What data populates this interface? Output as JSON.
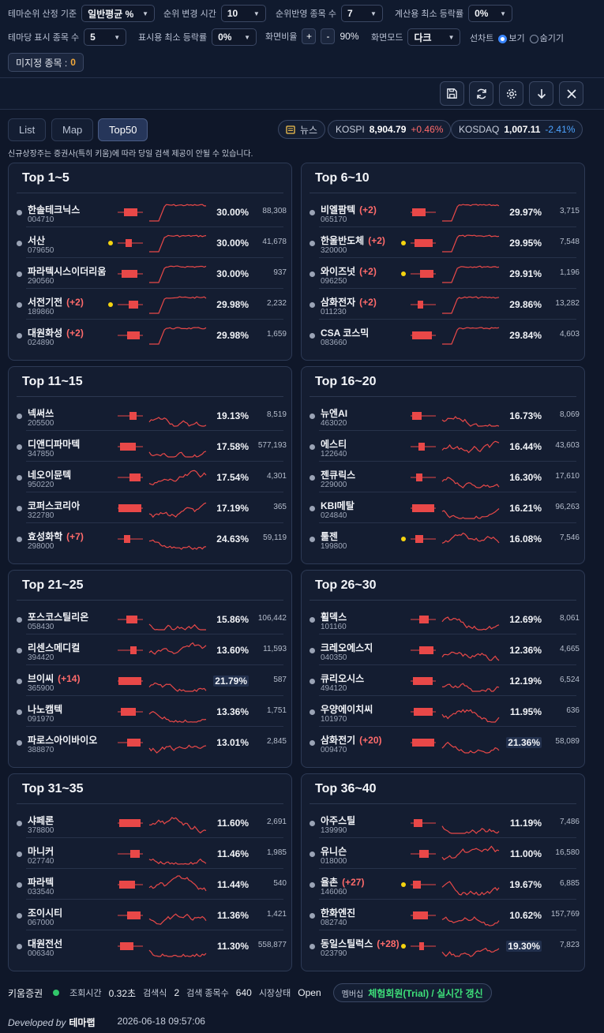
{
  "controls": {
    "theme_rank_basis_label": "테마순위 산정 기준",
    "theme_rank_basis_value": "일반평균 %",
    "rank_change_time_label": "순위 변경 시간",
    "rank_change_time_value": "10",
    "rank_stock_count_label": "순위반영 종목 수",
    "rank_stock_count_value": "7",
    "calc_min_rise_label": "계산용 최소 등락률",
    "calc_min_rise_value": "0%",
    "per_theme_count_label": "테마당 표시 종목 수",
    "per_theme_count_value": "5",
    "display_min_rise_label": "표시용 최소 등락률",
    "display_min_rise_value": "0%",
    "screen_ratio_label": "화면비율",
    "plus": "+",
    "minus": "-",
    "screen_ratio_value": "90%",
    "screen_mode_label": "화면모드",
    "screen_mode_value": "다크",
    "line_chart_label": "선차트",
    "show_label": "보기",
    "hide_label": "숨기기",
    "unassigned_label": "미지정 종목 :",
    "unassigned_count": "0"
  },
  "toolbar_icons": [
    "save-icon",
    "refresh-icon",
    "settings-icon",
    "download-icon",
    "close-icon"
  ],
  "tabs": [
    "List",
    "Map",
    "Top50"
  ],
  "active_tab": "Top50",
  "news_label": "뉴스",
  "indices": [
    {
      "name": "KOSPI",
      "value": "8,904.79",
      "change": "+0.46%",
      "dir": "up"
    },
    {
      "name": "KOSDAQ",
      "value": "1,007.11",
      "change": "-2.41%",
      "dir": "dn"
    }
  ],
  "notice": "신규상장주는 증권사(특히 키움)에 따라 당일 검색 제공이 안될 수 있습니다.",
  "panels": [
    {
      "title": "Top 1~5",
      "items": [
        {
          "name": "한솔테크닉스",
          "code": "004710",
          "tag": "",
          "pct": "30.00%",
          "vol": "88,308",
          "ydot": false,
          "hl": false
        },
        {
          "name": "서산",
          "code": "079650",
          "tag": "",
          "pct": "30.00%",
          "vol": "41,678",
          "ydot": true,
          "hl": false
        },
        {
          "name": "파라텍시스이더리움",
          "code": "290560",
          "tag": "",
          "pct": "30.00%",
          "vol": "937",
          "ydot": false,
          "hl": false
        },
        {
          "name": "서전기전",
          "code": "189860",
          "tag": "(+2)",
          "pct": "29.98%",
          "vol": "2,232",
          "ydot": true,
          "hl": false
        },
        {
          "name": "대원화성",
          "code": "024890",
          "tag": "(+2)",
          "pct": "29.98%",
          "vol": "1,659",
          "ydot": false,
          "hl": false
        }
      ]
    },
    {
      "title": "Top 6~10",
      "items": [
        {
          "name": "비엘팜텍",
          "code": "065170",
          "tag": "(+2)",
          "pct": "29.97%",
          "vol": "3,715",
          "ydot": false,
          "hl": false
        },
        {
          "name": "한울반도체",
          "code": "320000",
          "tag": "(+2)",
          "pct": "29.95%",
          "vol": "7,548",
          "ydot": true,
          "hl": false
        },
        {
          "name": "와이즈넛",
          "code": "096250",
          "tag": "(+2)",
          "pct": "29.91%",
          "vol": "1,196",
          "ydot": true,
          "hl": false
        },
        {
          "name": "삼화전자",
          "code": "011230",
          "tag": "(+2)",
          "pct": "29.86%",
          "vol": "13,282",
          "ydot": false,
          "hl": false
        },
        {
          "name": "CSA 코스믹",
          "code": "083660",
          "tag": "",
          "pct": "29.84%",
          "vol": "4,603",
          "ydot": false,
          "hl": false
        }
      ]
    },
    {
      "title": "Top 11~15",
      "items": [
        {
          "name": "넥써쓰",
          "code": "205500",
          "tag": "",
          "pct": "19.13%",
          "vol": "8,519",
          "ydot": false,
          "hl": false
        },
        {
          "name": "디앤디파마텍",
          "code": "347850",
          "tag": "",
          "pct": "17.58%",
          "vol": "577,193",
          "ydot": false,
          "hl": false
        },
        {
          "name": "네오이뮨텍",
          "code": "950220",
          "tag": "",
          "pct": "17.54%",
          "vol": "4,301",
          "ydot": false,
          "hl": false
        },
        {
          "name": "코퍼스코리아",
          "code": "322780",
          "tag": "",
          "pct": "17.19%",
          "vol": "365",
          "ydot": false,
          "hl": false
        },
        {
          "name": "효성화학",
          "code": "298000",
          "tag": "(+7)",
          "pct": "24.63%",
          "vol": "59,119",
          "ydot": false,
          "hl": false
        }
      ]
    },
    {
      "title": "Top 16~20",
      "items": [
        {
          "name": "뉴엔AI",
          "code": "463020",
          "tag": "",
          "pct": "16.73%",
          "vol": "8,069",
          "ydot": false,
          "hl": false
        },
        {
          "name": "에스티",
          "code": "122640",
          "tag": "",
          "pct": "16.44%",
          "vol": "43,603",
          "ydot": false,
          "hl": false
        },
        {
          "name": "젠큐릭스",
          "code": "229000",
          "tag": "",
          "pct": "16.30%",
          "vol": "17,610",
          "ydot": false,
          "hl": false
        },
        {
          "name": "KBI메탈",
          "code": "024840",
          "tag": "",
          "pct": "16.21%",
          "vol": "96,263",
          "ydot": false,
          "hl": false
        },
        {
          "name": "툴젠",
          "code": "199800",
          "tag": "",
          "pct": "16.08%",
          "vol": "7,546",
          "ydot": true,
          "hl": false
        }
      ]
    },
    {
      "title": "Top 21~25",
      "items": [
        {
          "name": "포스코스틸리온",
          "code": "058430",
          "tag": "",
          "pct": "15.86%",
          "vol": "106,442",
          "ydot": false,
          "hl": false
        },
        {
          "name": "리센스메디컬",
          "code": "394420",
          "tag": "",
          "pct": "13.60%",
          "vol": "11,593",
          "ydot": false,
          "hl": false
        },
        {
          "name": "브이씨",
          "code": "365900",
          "tag": "(+14)",
          "pct": "21.79%",
          "vol": "587",
          "ydot": false,
          "hl": true
        },
        {
          "name": "나노캠텍",
          "code": "091970",
          "tag": "",
          "pct": "13.36%",
          "vol": "1,751",
          "ydot": false,
          "hl": false
        },
        {
          "name": "파로스아이바이오",
          "code": "388870",
          "tag": "",
          "pct": "13.01%",
          "vol": "2,845",
          "ydot": false,
          "hl": false
        }
      ]
    },
    {
      "title": "Top 26~30",
      "items": [
        {
          "name": "휠덱스",
          "code": "101160",
          "tag": "",
          "pct": "12.69%",
          "vol": "8,061",
          "ydot": false,
          "hl": false
        },
        {
          "name": "크레오에스지",
          "code": "040350",
          "tag": "",
          "pct": "12.36%",
          "vol": "4,665",
          "ydot": false,
          "hl": false
        },
        {
          "name": "큐리오시스",
          "code": "494120",
          "tag": "",
          "pct": "12.19%",
          "vol": "6,524",
          "ydot": false,
          "hl": false
        },
        {
          "name": "우양에이치씨",
          "code": "101970",
          "tag": "",
          "pct": "11.95%",
          "vol": "636",
          "ydot": false,
          "hl": false
        },
        {
          "name": "삼화전기",
          "code": "009470",
          "tag": "(+20)",
          "pct": "21.36%",
          "vol": "58,089",
          "ydot": false,
          "hl": true
        }
      ]
    },
    {
      "title": "Top 31~35",
      "items": [
        {
          "name": "샤페론",
          "code": "378800",
          "tag": "",
          "pct": "11.60%",
          "vol": "2,691",
          "ydot": false,
          "hl": false
        },
        {
          "name": "마니커",
          "code": "027740",
          "tag": "",
          "pct": "11.46%",
          "vol": "1,985",
          "ydot": false,
          "hl": false
        },
        {
          "name": "파라텍",
          "code": "033540",
          "tag": "",
          "pct": "11.44%",
          "vol": "540",
          "ydot": false,
          "hl": false
        },
        {
          "name": "조이시티",
          "code": "067000",
          "tag": "",
          "pct": "11.36%",
          "vol": "1,421",
          "ydot": false,
          "hl": false
        },
        {
          "name": "대원전선",
          "code": "006340",
          "tag": "",
          "pct": "11.30%",
          "vol": "558,877",
          "ydot": false,
          "hl": false
        }
      ]
    },
    {
      "title": "Top 36~40",
      "items": [
        {
          "name": "아주스틸",
          "code": "139990",
          "tag": "",
          "pct": "11.19%",
          "vol": "7,486",
          "ydot": false,
          "hl": false
        },
        {
          "name": "유니슨",
          "code": "018000",
          "tag": "",
          "pct": "11.00%",
          "vol": "16,580",
          "ydot": false,
          "hl": false
        },
        {
          "name": "율촌",
          "code": "146060",
          "tag": "(+27)",
          "pct": "19.67%",
          "vol": "6,885",
          "ydot": true,
          "hl": false
        },
        {
          "name": "한화엔진",
          "code": "082740",
          "tag": "",
          "pct": "10.62%",
          "vol": "157,769",
          "ydot": false,
          "hl": false
        },
        {
          "name": "동일스틸럭스",
          "code": "023790",
          "tag": "(+28)",
          "pct": "19.30%",
          "vol": "7,823",
          "ydot": true,
          "hl": true
        }
      ]
    }
  ],
  "status": {
    "broker": "키움증권",
    "query_time_label": "조회시간",
    "query_time": "0.32초",
    "search_label": "검색식",
    "search_count": "2",
    "stock_count_label": "검색 종목수",
    "stock_count": "640",
    "market_label": "시장상태",
    "market_state": "Open",
    "member_label": "멤버십",
    "member_value": "체험회원(Trial) / 실시간 갱신"
  },
  "footer": {
    "developed_by": "Developed by",
    "brand": "테마랩",
    "datetime": "2026-06-18 09:57:06"
  },
  "colors": {
    "accent": "#ff6b6b",
    "down": "#4da3ff",
    "chart_red": "#e84848",
    "member_green": "#3ee07a",
    "count_orange": "#f2a93b"
  }
}
